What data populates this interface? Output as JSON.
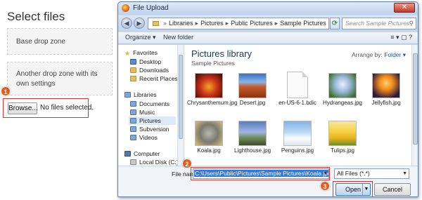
{
  "page": {
    "title": "Select files",
    "dropzone1": "Base drop zone",
    "dropzone2": "Another drop zone with its own settings",
    "browse_label": "Browse...",
    "no_file_text": "No files selected."
  },
  "callouts": [
    "1",
    "2",
    "3"
  ],
  "dialog": {
    "title": "File Upload",
    "close_label": "✕",
    "address": [
      "Libraries",
      "Pictures",
      "Public Pictures",
      "Sample Pictures"
    ],
    "search_placeholder": "Search Sample Pictures",
    "toolbar": {
      "organize": "Organize ▾",
      "new_folder": "New folder",
      "right": "≡ ▾   ▢   ?"
    },
    "nav": {
      "favorites": "Favorites",
      "desktop": "Desktop",
      "downloads": "Downloads",
      "recent": "Recent Places",
      "libraries": "Libraries",
      "documents": "Documents",
      "music": "Music",
      "pictures": "Pictures",
      "subversion": "Subversion",
      "videos": "Videos",
      "computer": "Computer",
      "local_disk": "Local Disk (C:)"
    },
    "library_title": "Pictures library",
    "library_subtitle": "Sample Pictures",
    "arrange_label": "Arrange by:",
    "arrange_value": "Folder ▾",
    "files": [
      "Chrysanthemum.jpg",
      "Desert.jpg",
      "en-US-6-1.bdic",
      "Hydrangeas.jpg",
      "Jellyfish.jpg",
      "Koala.jpg",
      "Lighthouse.jpg",
      "Penguins.jpg",
      "Tulips.jpg"
    ],
    "file_name_label": "File name:",
    "file_name_value": "C:\\Users\\Public\\Pictures\\Sample Pictures\\Koala.jpg",
    "file_type": "All Files (*.*)",
    "open_label": "Open",
    "cancel_label": "Cancel"
  },
  "colors": {
    "callout": "#e35b1f",
    "highlight": "#d9342b",
    "selection": "#3478d4"
  }
}
